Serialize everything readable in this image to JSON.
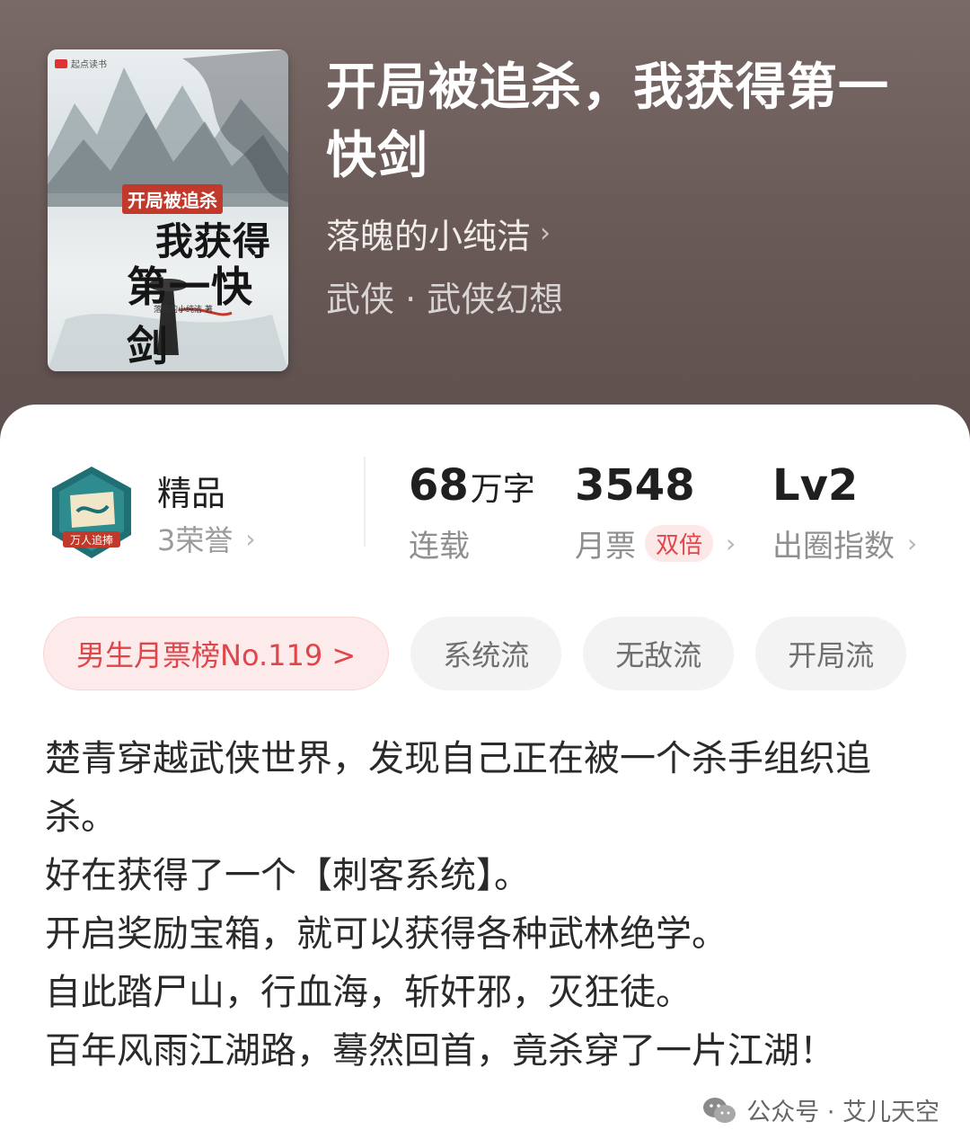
{
  "cover": {
    "brand": "起点读书",
    "subtitle": "开局被追杀",
    "title_line1": "我获得",
    "title_line2": "第一快剑",
    "author": "落魄的小纯洁 著"
  },
  "book": {
    "title": "开局被追杀，我获得第一快剑",
    "author": "落魄的小纯洁",
    "genre": "武侠 · 武侠幻想"
  },
  "quality": {
    "badge_text": "万人追捧",
    "label": "精品",
    "honors": "3荣誉"
  },
  "stats": {
    "word_count": {
      "value": "68",
      "unit": "万字",
      "label": "连载"
    },
    "monthly_ticket": {
      "value": "3548",
      "label": "月票",
      "tag": "双倍"
    },
    "popularity": {
      "value": "Lv2",
      "label": "出圈指数"
    }
  },
  "tags": [
    "男生月票榜No.119 >",
    "系统流",
    "无敌流",
    "开局流"
  ],
  "intro": [
    "楚青穿越武侠世界，发现自己正在被一个杀手组织追杀。",
    "好在获得了一个【刺客系统】。",
    "开启奖励宝箱，就可以获得各种武林绝学。",
    "自此踏尸山，行血海，斩奸邪，灭狂徒。",
    "百年风雨江湖路，蓦然回首，竟杀穿了一片江湖！"
  ],
  "watermark": "公众号 · 艾儿天空",
  "colors": {
    "accent": "#e0454a",
    "hero_bg": "#6a5a58"
  }
}
